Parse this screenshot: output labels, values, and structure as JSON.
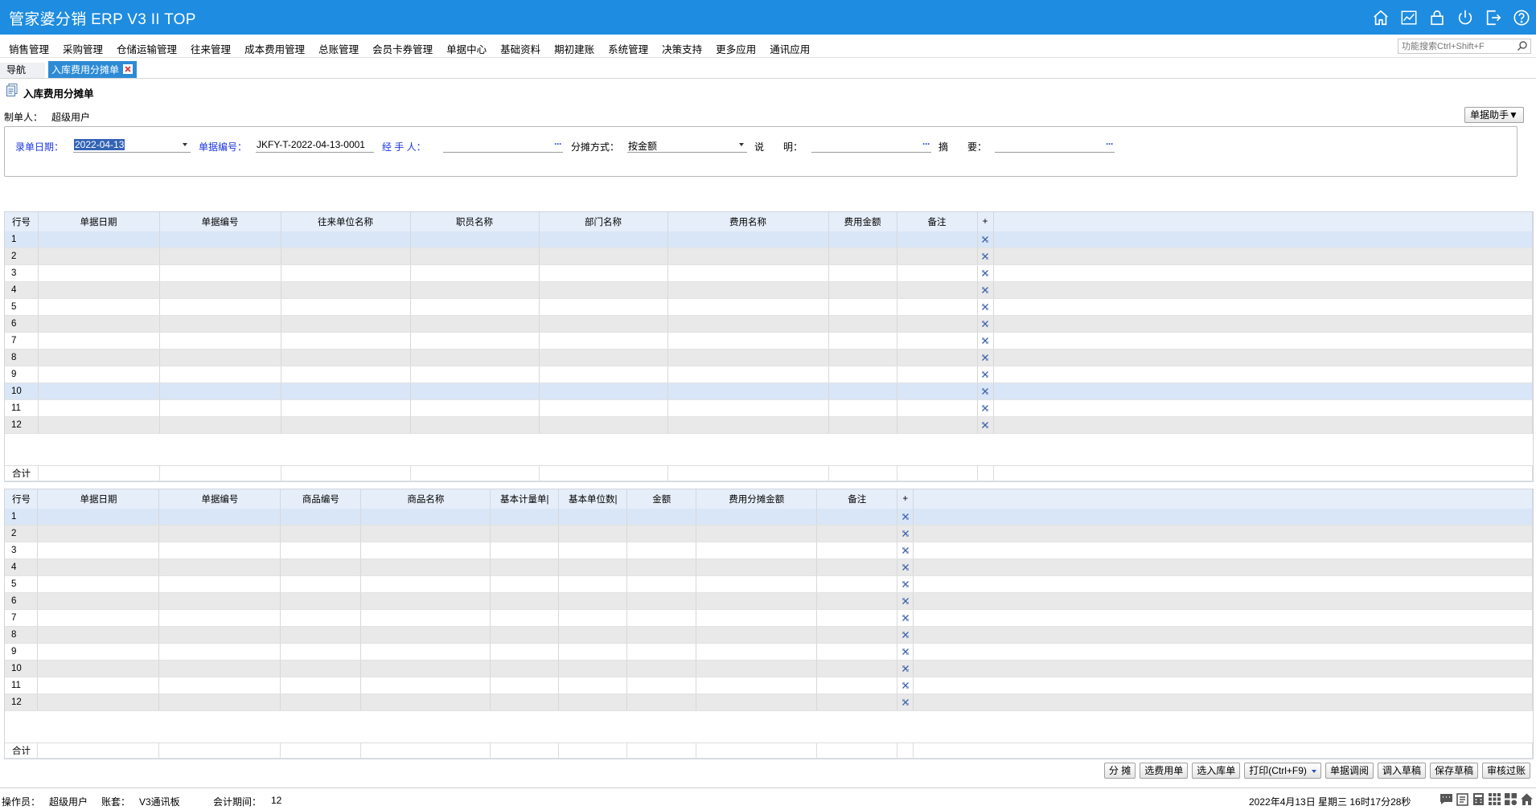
{
  "app": {
    "title": "管家婆分销 ERP V3 II TOP"
  },
  "titlebar_icons": [
    "home-icon",
    "chart-icon",
    "lock-icon",
    "power-icon",
    "exit-icon",
    "help-icon"
  ],
  "menu": [
    "销售管理",
    "采购管理",
    "仓储运输管理",
    "往来管理",
    "成本费用管理",
    "总账管理",
    "会员卡券管理",
    "单据中心",
    "基础资料",
    "期初建账",
    "系统管理",
    "决策支持",
    "更多应用",
    "通讯应用"
  ],
  "search": {
    "placeholder": "功能搜索Ctrl+Shift+F"
  },
  "tabs": {
    "nav": "导航",
    "active": "入库费用分摊单"
  },
  "page": {
    "title": "入库费用分摊单",
    "creator_label": "制单人：",
    "creator_value": "超级用户",
    "assist_button": "单据助手▼"
  },
  "form": {
    "date_label": "录单日期：",
    "date_value": "2022-04-13",
    "billno_label": "单据编号：",
    "billno_value": "JKFY-T-2022-04-13-0001",
    "handler_label": "经 手 人：",
    "handler_value": "",
    "method_label": "分摊方式：",
    "method_value": "按金额",
    "desc_label": "说　　明：",
    "desc_value": "",
    "summary_label": "摘　　要：",
    "summary_value": "",
    "ellipsis": "···"
  },
  "grid1": {
    "headers": [
      "行号",
      "单据日期",
      "单据编号",
      "往来单位名称",
      "职员名称",
      "部门名称",
      "费用名称",
      "费用金额",
      "备注",
      "+"
    ],
    "rows": [
      "1",
      "2",
      "3",
      "4",
      "5",
      "6",
      "7",
      "8",
      "9",
      "10",
      "11",
      "12"
    ],
    "total_label": "合计"
  },
  "grid2": {
    "headers": [
      "行号",
      "单据日期",
      "单据编号",
      "商品编号",
      "商品名称",
      "基本计量单|",
      "基本单位数|",
      "金额",
      "费用分摊金额",
      "备注",
      "+"
    ],
    "rows": [
      "1",
      "2",
      "3",
      "4",
      "5",
      "6",
      "7",
      "8",
      "9",
      "10",
      "11",
      "12"
    ],
    "total_label": "合计"
  },
  "actions": [
    "分 摊",
    "选费用单",
    "选入库单",
    "打印(Ctrl+F9)",
    "单据调阅",
    "调入草稿",
    "保存草稿",
    "审核过账"
  ],
  "status": {
    "operator_label": "操作员：",
    "operator_value": "超级用户",
    "account_label": "账套：",
    "account_value": "V3通讯板",
    "period_label": "会计期间：",
    "period_value": "12",
    "datetime": "2022年4月13日  星期三  16时17分28秒"
  },
  "status_icons": [
    "message-icon",
    "note-icon",
    "calculator-icon",
    "grid-icon",
    "apps-icon",
    "home-icon"
  ],
  "colors": {
    "titlebar": "#1e8ce0",
    "tab_active": "#2d8bd6",
    "label_blue": "#1a35e0",
    "row_selected": "#d9e6f7",
    "row_alt": "#e9e9e9"
  }
}
